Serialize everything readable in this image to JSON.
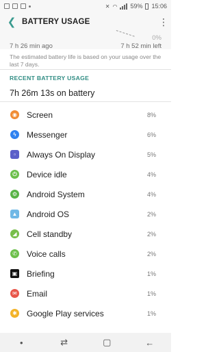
{
  "status": {
    "icons_left": [
      "notification-icon-1",
      "notification-icon-2",
      "notification-icon-3"
    ],
    "battery_pct": "59%",
    "time": "15:06"
  },
  "header": {
    "title": "BATTERY USAGE"
  },
  "graph": {
    "zero_label": "0%",
    "left_time": "7 h 26 min ago",
    "right_time": "7 h 52 min left"
  },
  "estimate_note": "The estimated battery life is based on your usage over the last 7 days.",
  "section_title": "RECENT BATTERY USAGE",
  "total_time": "7h 26m 13s on battery",
  "items": [
    {
      "label": "Screen",
      "pct": "8%",
      "icon": "screen-icon",
      "color": "#f08c34"
    },
    {
      "label": "Messenger",
      "pct": "6%",
      "icon": "messenger-icon",
      "color": "#2f82f0"
    },
    {
      "label": "Always On Display",
      "pct": "5%",
      "icon": "always-on-display-icon",
      "color": "#5b5fc9"
    },
    {
      "label": "Device idle",
      "pct": "4%",
      "icon": "device-idle-icon",
      "color": "#6cbf4b"
    },
    {
      "label": "Android System",
      "pct": "4%",
      "icon": "android-system-icon",
      "color": "#58b346"
    },
    {
      "label": "Android OS",
      "pct": "2%",
      "icon": "android-os-icon",
      "color": "#6fb8e6"
    },
    {
      "label": "Cell standby",
      "pct": "2%",
      "icon": "cell-standby-icon",
      "color": "#78be4a"
    },
    {
      "label": "Voice calls",
      "pct": "2%",
      "icon": "voice-calls-icon",
      "color": "#6cbf4b"
    },
    {
      "label": "Briefing",
      "pct": "1%",
      "icon": "briefing-icon",
      "color": "#111111"
    },
    {
      "label": "Email",
      "pct": "1%",
      "icon": "email-icon",
      "color": "#e8564a"
    },
    {
      "label": "Google Play services",
      "pct": "1%",
      "icon": "google-play-services-icon",
      "color": "#f3b329"
    }
  ]
}
